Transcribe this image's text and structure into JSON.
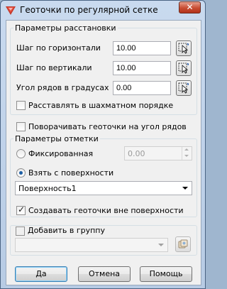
{
  "window": {
    "title": "Геоточки по регулярной сетке",
    "close_glyph": "✕"
  },
  "placement": {
    "group_title": "Параметры расстановки",
    "horizontal_step_label": "Шаг по горизонтали",
    "horizontal_step_value": "10.00",
    "vertical_step_label": "Шаг по вертикали",
    "vertical_step_value": "10.00",
    "row_angle_label": "Угол рядов в градусах",
    "row_angle_value": "0.00",
    "checker_label": "Расставлять в шахматном порядке",
    "checker_checked": false
  },
  "rotate_label": "Поворачивать геоточки на угол рядов",
  "rotate_checked": false,
  "marks": {
    "group_title": "Параметры отметки",
    "fixed_label": "Фиксированная",
    "fixed_value": "0.00",
    "from_surface_label": "Взять с поверхности",
    "surface_selected": "Поверхность1",
    "create_outside_label": "Создавать геоточки вне поверхности",
    "create_outside_checked": true
  },
  "group": {
    "add_to_group_label": "Добавить в группу",
    "add_checked": false,
    "group_value": ""
  },
  "buttons": {
    "ok": "Да",
    "cancel": "Отмена",
    "help": "Помощь"
  },
  "icons": {
    "app": "layers-app-icon",
    "pick": "pick-from-drawing-icon",
    "group_pick": "pick-group-icon"
  }
}
